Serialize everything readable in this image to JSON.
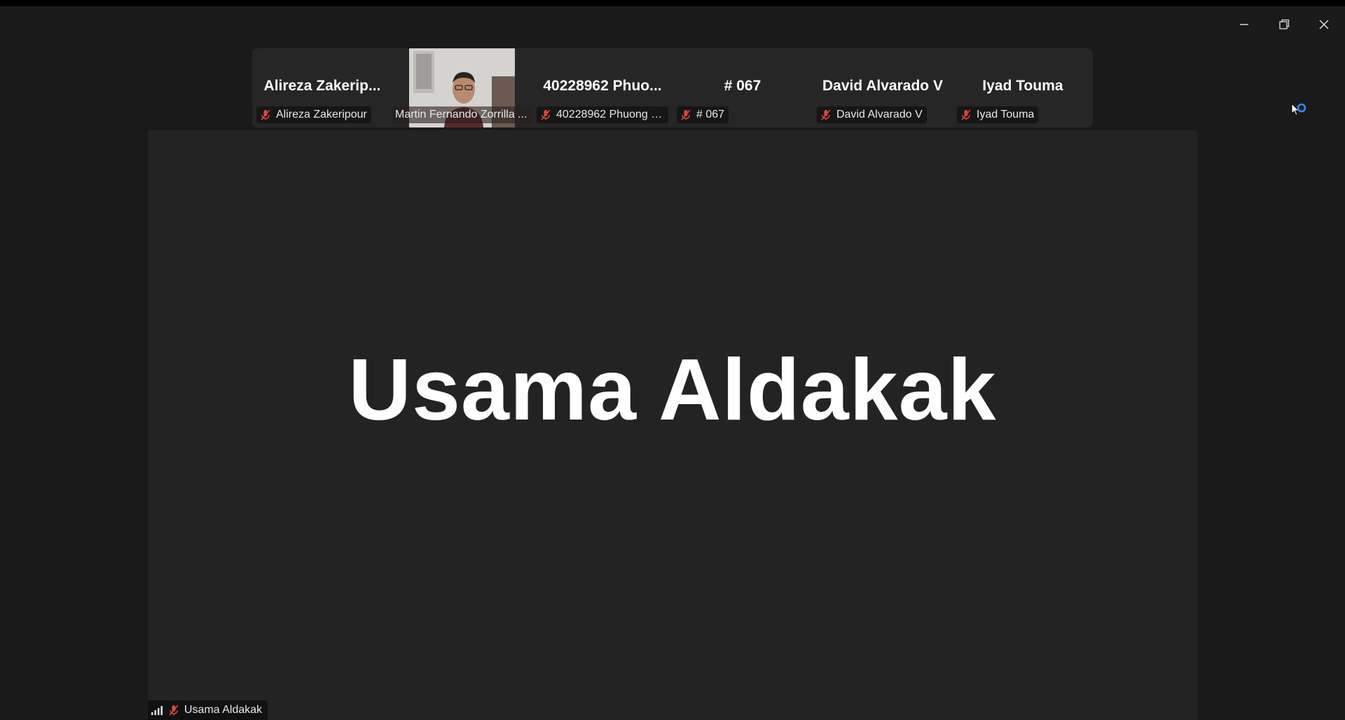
{
  "window": {
    "controls": {
      "minimize_icon": "minimize-icon",
      "restore_icon": "restore-icon",
      "close_icon": "close-icon"
    }
  },
  "participants_strip": [
    {
      "display_name": "Alireza Zakerip...",
      "label": "Alireza Zakeripour",
      "muted": true,
      "video": false
    },
    {
      "display_name": "",
      "label": "Martin Fernando Zorrilla ...",
      "muted": false,
      "video": true
    },
    {
      "display_name": "40228962 Phuo...",
      "label": "40228962 Phuong Kh...",
      "muted": true,
      "video": false
    },
    {
      "display_name": "# 067",
      "label": "# 067",
      "muted": true,
      "video": false
    },
    {
      "display_name": "David Alvarado V",
      "label": "David Alvarado V",
      "muted": true,
      "video": false
    },
    {
      "display_name": "Iyad Touma",
      "label": "Iyad Touma",
      "muted": true,
      "video": false
    }
  ],
  "active_speaker": {
    "display_name": "Usama Aldakak",
    "label": "Usama Aldakak",
    "muted": true,
    "signal_icon": "signal-strength-icon"
  },
  "colors": {
    "background": "#1a1a1a",
    "tile_background": "#262626",
    "speaker_background": "#232323",
    "muted_icon": "#e0443e",
    "loading_spinner": "#2d8cff"
  }
}
